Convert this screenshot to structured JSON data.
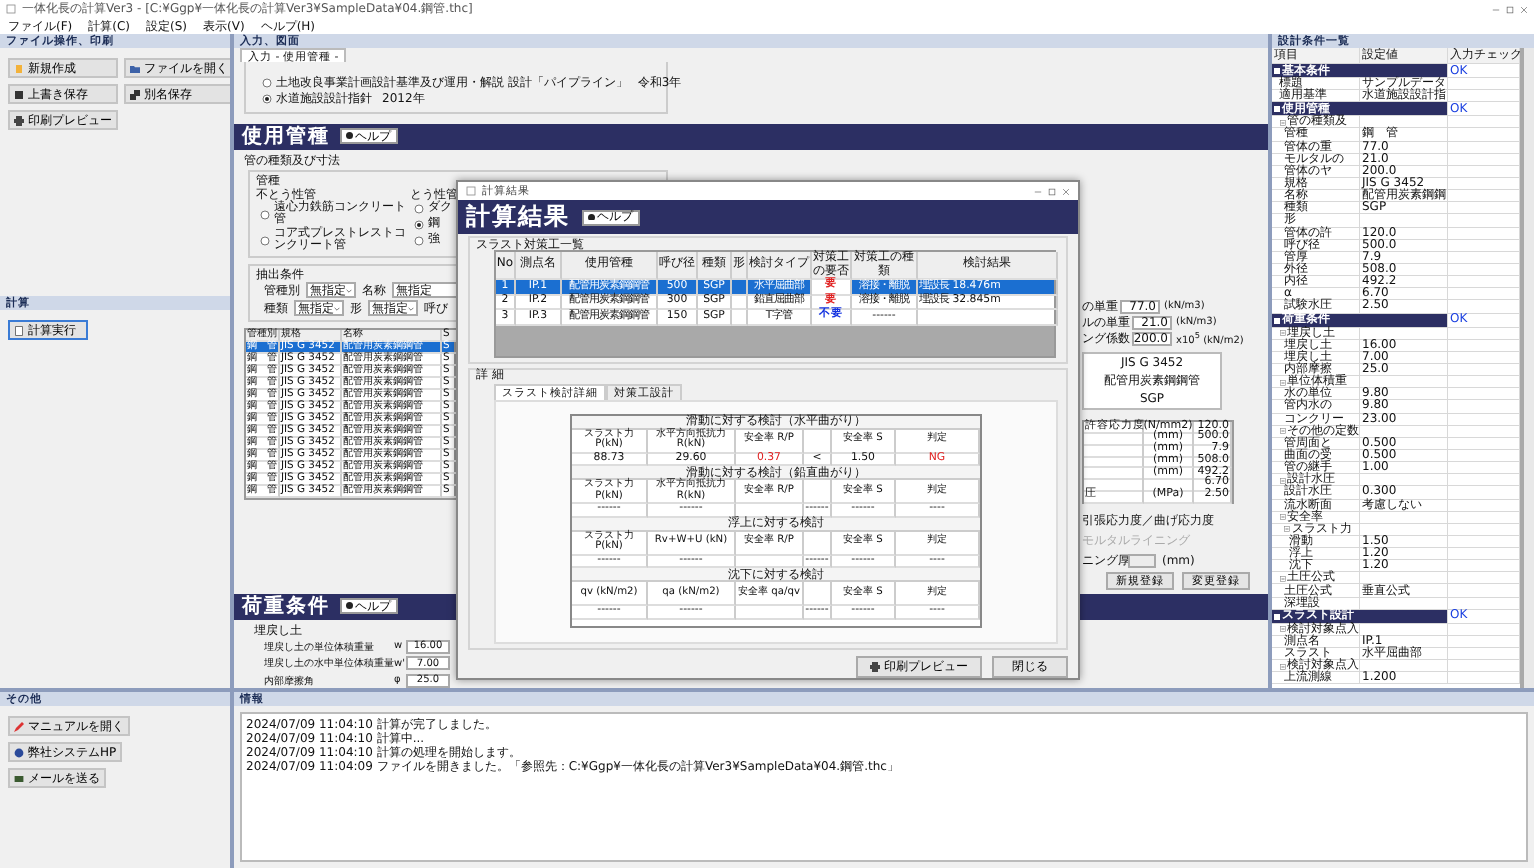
{
  "window": {
    "title": "一体化長の計算Ver3 - [C:¥Ggp¥一体化長の計算Ver3¥SampleData¥04.鋼管.thc]"
  },
  "menu": [
    "ファイル(F)",
    "計算(C)",
    "設定(S)",
    "表示(V)",
    "ヘルプ(H)"
  ],
  "file_panel": {
    "title": "ファイル操作、印刷",
    "buttons": [
      "新規作成",
      "ファイルを開く",
      "上書き保存",
      "別名保存",
      "印刷プレビュー"
    ]
  },
  "calc_panel": {
    "title": "計算",
    "buttons": [
      "計算実行"
    ]
  },
  "other_panel": {
    "title": "その他",
    "buttons": [
      "マニュアルを開く",
      "弊社システムHP",
      "メールを送る"
    ]
  },
  "input_panel": {
    "title": "入力、図面",
    "tabs": [
      {
        "label": "入力 - 使用管種 -",
        "selected": true
      }
    ],
    "standards": [
      {
        "label": "土地改良事業計画設計基準及び運用・解説 設計「パイプライン」",
        "year": "令和3年",
        "selected": false
      },
      {
        "label": "水道施設設計指針",
        "year": "2012年",
        "selected": true
      }
    ],
    "pipe_section": {
      "title": "使用管種",
      "help": "ヘルプ",
      "group_label": "管の種類及び寸法",
      "pipe_label": "管種",
      "rigid": {
        "label": "不とう性管",
        "options": [
          {
            "label": "遠心力鉄筋コンクリート管",
            "selected": false
          },
          {
            "label": "コア式プレストレストコンクリート管",
            "selected": false
          }
        ]
      },
      "flexible": {
        "label": "とう性管",
        "options": [
          {
            "label": "ダク",
            "selected": false
          },
          {
            "label": "鋼",
            "selected": true
          },
          {
            "label": "強",
            "selected": false
          }
        ]
      },
      "filter": {
        "title": "抽出条件",
        "fields": [
          {
            "label": "管種別",
            "value": "無指定",
            "kind": "dropdown"
          },
          {
            "label": "名称",
            "value": "無指定",
            "kind": "text"
          },
          {
            "label": "種類",
            "value": "無指定",
            "kind": "dropdown"
          },
          {
            "label": "形",
            "value": "無指定",
            "kind": "dropdown"
          },
          {
            "label": "呼び",
            "kind": "label"
          }
        ]
      },
      "table": {
        "columns": [
          "管種別",
          "規格",
          "名称",
          "S"
        ],
        "rows": [
          {
            "cells": [
              "鋼　管",
              "JIS G 3452",
              "配管用炭素鋼鋼管",
              "S"
            ],
            "selected": true
          },
          {
            "cells": [
              "鋼　管",
              "JIS G 3452",
              "配管用炭素鋼鋼管",
              "S"
            ],
            "selected": false
          },
          {
            "cells": [
              "鋼　管",
              "JIS G 3452",
              "配管用炭素鋼鋼管",
              "S"
            ],
            "selected": false
          },
          {
            "cells": [
              "鋼　管",
              "JIS G 3452",
              "配管用炭素鋼鋼管",
              "S"
            ],
            "selected": false
          },
          {
            "cells": [
              "鋼　管",
              "JIS G 3452",
              "配管用炭素鋼鋼管",
              "S"
            ],
            "selected": false
          },
          {
            "cells": [
              "鋼　管",
              "JIS G 3452",
              "配管用炭素鋼鋼管",
              "S"
            ],
            "selected": false
          },
          {
            "cells": [
              "鋼　管",
              "JIS G 3452",
              "配管用炭素鋼鋼管",
              "S"
            ],
            "selected": false
          },
          {
            "cells": [
              "鋼　管",
              "JIS G 3452",
              "配管用炭素鋼鋼管",
              "S"
            ],
            "selected": false
          },
          {
            "cells": [
              "鋼　管",
              "JIS G 3452",
              "配管用炭素鋼鋼管",
              "S"
            ],
            "selected": false
          },
          {
            "cells": [
              "鋼　管",
              "JIS G 3452",
              "配管用炭素鋼鋼管",
              "S"
            ],
            "selected": false
          },
          {
            "cells": [
              "鋼　管",
              "JIS G 3452",
              "配管用炭素鋼鋼管",
              "S"
            ],
            "selected": false
          },
          {
            "cells": [
              "鋼　管",
              "JIS G 3452",
              "配管用炭素鋼鋼管",
              "S"
            ],
            "selected": false
          },
          {
            "cells": [
              "鋼　管",
              "JIS G 3452",
              "配管用炭素鋼鋼管",
              "S"
            ],
            "selected": false
          }
        ]
      },
      "weights": [
        {
          "label": "の単重",
          "value": "77.0",
          "unit": "(kN/m3)"
        },
        {
          "label": "ルの単重",
          "value": "21.0",
          "unit": "(kN/m3)"
        },
        {
          "label": "ング係数",
          "value": "200.0",
          "unit": "x10$^{5}$ (kN/m2)"
        }
      ],
      "spec": [
        "JIS G 3452",
        "配管用炭素鋼鋼管",
        "SGP"
      ],
      "properties": [
        {
          "label": "許容応力度",
          "unit": "(N/mm2)",
          "value": "120.0"
        },
        {
          "unit": "(mm)",
          "value": "500.0"
        },
        {
          "unit": "(mm)",
          "value": "7.9"
        },
        {
          "unit": "(mm)",
          "value": "508.0"
        },
        {
          "unit": "(mm)",
          "value": "492.2"
        },
        {
          "value": "6.70"
        },
        {
          "label": "圧",
          "unit": "(MPa)",
          "value": "2.50"
        }
      ],
      "stress_label": "引張応力度／曲げ応力度",
      "lining": {
        "label": "モルタルライニング",
        "disabled": true
      },
      "lining_thickness": {
        "label": "ニング厚",
        "unit": "(mm)"
      },
      "buttons": [
        "新規登録",
        "変更登録"
      ]
    },
    "load_section": {
      "title": "荷重条件",
      "help": "ヘルプ",
      "group_label": "埋戻し土",
      "rows": [
        {
          "label": "埋戻し土の単位体積重量",
          "symbol": "w",
          "value": "16.00"
        },
        {
          "label": "埋戻し土の水中単位体積重量",
          "symbol": "w'",
          "value": "7.00"
        },
        {
          "label": "内部摩擦角",
          "symbol": "φ",
          "value": "25.0"
        }
      ]
    }
  },
  "log": {
    "title": "情報",
    "lines": [
      "2024/07/09 11:04:10 計算が完了しました。",
      "2024/07/09 11:04:10 計算中...",
      "2024/07/09 11:04:10 計算の処理を開始します。",
      "2024/07/09 11:04:09 ファイルを開きました。「参照先：C:¥Ggp¥一体化長の計算Ver3¥SampleData¥04.鋼管.thc」"
    ]
  },
  "dialog": {
    "title": "計算結果",
    "banner": "計算結果",
    "help": "ヘルプ",
    "list_title": "スラスト対策工一覧",
    "columns": [
      "No",
      "測点名",
      "使用管種",
      "呼び径",
      "種類",
      "形",
      "検討タイプ",
      "対策工の要否",
      "対策工の種類",
      "検討結果"
    ],
    "rows": [
      {
        "no": "1",
        "name": "IP.1",
        "pipe": "配管用炭素鋼鋼管",
        "diameter": "500",
        "type": "SGP",
        "check_type": "水平屈曲部",
        "needed": "要",
        "measure": "溶接・離脱",
        "result": "埋設長 18.476m",
        "color": "#e02020",
        "selected": true
      },
      {
        "no": "2",
        "name": "IP.2",
        "pipe": "配管用炭素鋼鋼管",
        "diameter": "300",
        "type": "SGP",
        "check_type": "鉛直屈曲部",
        "needed": "要",
        "measure": "溶接・離脱",
        "result": "埋設長 32.845m",
        "color": "#e02020",
        "selected": false
      },
      {
        "no": "3",
        "name": "IP.3",
        "pipe": "配管用炭素鋼鋼管",
        "diameter": "150",
        "type": "SGP",
        "check_type": "T字管",
        "needed": "不要",
        "measure": "------",
        "color": "#1030e0",
        "selected": false
      }
    ],
    "detail_title": "詳 細",
    "tabs": [
      {
        "label": "スラスト検討詳細",
        "selected": true
      },
      {
        "label": "対策工設計",
        "selected": false
      }
    ],
    "checks": [
      {
        "title": "滑動に対する検討（水平曲がり）",
        "headers": {
          "force": "スラスト力 P(kN)",
          "resistance": "水平方向抵抗力 R(kN)",
          "ratio": "安全率 R/P",
          "safety": "安全率 S",
          "verdict": "判定"
        },
        "values": {
          "force": "88.73",
          "resistance": "29.60",
          "ratio": "0.37",
          "compare": "<",
          "safety": "1.50",
          "verdict": "NG"
        },
        "ng": true
      },
      {
        "title": "滑動に対する検討（鉛直曲がり）",
        "headers": {
          "force": "スラスト力 P(kN)",
          "resistance": "水平方向抵抗力 R(kN)",
          "ratio": "安全率 R/P",
          "safety": "安全率 S",
          "verdict": "判定"
        },
        "values": {
          "force": "------",
          "resistance": "------",
          "compare": "------",
          "safety": "------",
          "verdict": "----"
        },
        "ng": false
      },
      {
        "title": "浮上に対する検討",
        "headers": {
          "force": "スラスト力 P(kN)",
          "resistance": "Rv+W+U (kN)",
          "ratio": "安全率 R/P",
          "safety": "安全率 S",
          "verdict": "判定"
        },
        "values": {
          "force": "------",
          "resistance": "------",
          "compare": "------",
          "safety": "------",
          "verdict": "----"
        },
        "ng": false
      },
      {
        "title": "沈下に対する検討",
        "headers": {
          "force": "qv (kN/m2)",
          "resistance": "qa (kN/m2)",
          "ratio": "安全率 qa/qv",
          "safety": "安全率 S",
          "verdict": "判定"
        },
        "values": {
          "force": "------",
          "resistance": "------",
          "compare": "------",
          "safety": "------",
          "verdict": "----"
        },
        "ng": false
      }
    ],
    "buttons": [
      "印刷プレビュー",
      "閉じる"
    ]
  },
  "conditions": {
    "title": "設計条件一覧",
    "columns": [
      "項目",
      "設定値",
      "入力チェック"
    ],
    "sections": [
      {
        "label": "基本条件",
        "check": "OK",
        "children": [
          {
            "label": "標題",
            "value": "サンプルデータ"
          },
          {
            "label": "適用基準",
            "value": "水道施設設計指"
          }
        ]
      },
      {
        "label": "使用管種",
        "check": "OK",
        "children": [
          {
            "label": "管の種類及",
            "expanded": true,
            "children": [
              {
                "label": "管種",
                "value": "鋼　管"
              },
              {
                "label": "管体の重",
                "value": "77.0"
              },
              {
                "label": "モルタルの",
                "value": "21.0"
              },
              {
                "label": "管体のヤ",
                "value": "200.0"
              },
              {
                "label": "規格",
                "value": "JIS G 3452"
              },
              {
                "label": "名称",
                "value": "配管用炭素鋼鋼"
              },
              {
                "label": "種類",
                "value": "SGP"
              },
              {
                "label": "形"
              },
              {
                "label": "管体の許",
                "value": "120.0"
              },
              {
                "label": "呼び径",
                "value": "500.0"
              },
              {
                "label": "管厚",
                "value": "7.9"
              },
              {
                "label": "外径",
                "value": "508.0"
              },
              {
                "label": "内径",
                "value": "492.2"
              },
              {
                "label": "α",
                "value": "6.70"
              },
              {
                "label": "試験水圧",
                "value": "2.50"
              }
            ]
          }
        ]
      },
      {
        "label": "荷重条件",
        "check": "OK",
        "children": [
          {
            "label": "埋戻し土",
            "expanded": true,
            "children": [
              {
                "label": "埋戻し土",
                "value": "16.00"
              },
              {
                "label": "埋戻し土",
                "value": "7.00"
              },
              {
                "label": "内部摩擦",
                "value": "25.0"
              }
            ]
          },
          {
            "label": "単位体積重",
            "expanded": true,
            "children": [
              {
                "label": "水の単位",
                "value": "9.80"
              },
              {
                "label": "管内水の",
                "value": "9.80"
              },
              {
                "label": "コンクリー",
                "value": "23.00"
              }
            ]
          },
          {
            "label": "その他の定数",
            "expanded": true,
            "children": [
              {
                "label": "管周面と",
                "value": "0.500"
              },
              {
                "label": "曲面の受",
                "value": "0.500"
              },
              {
                "label": "管の継手",
                "value": "1.00"
              }
            ]
          },
          {
            "label": "設計水圧",
            "expanded": true,
            "children": [
              {
                "label": "設計水圧",
                "value": "0.300"
              },
              {
                "label": "流水断面",
                "value": "考慮しない"
              }
            ]
          },
          {
            "label": "安全率",
            "expanded": true,
            "children": [
              {
                "label": "スラスト力",
                "expanded": true,
                "children": [
                  {
                    "label": "滑動",
                    "value": "1.50"
                  },
                  {
                    "label": "浮上",
                    "value": "1.20"
                  },
                  {
                    "label": "沈下",
                    "value": "1.20"
                  }
                ]
              }
            ]
          },
          {
            "label": "土圧公式",
            "expanded": true,
            "children": [
              {
                "label": "土圧公式",
                "value": "垂直公式"
              },
              {
                "label": "深埋設"
              }
            ]
          }
        ]
      },
      {
        "label": "スラスト設計",
        "check": "OK",
        "children": [
          {
            "label": "検討対象点入",
            "expanded": true,
            "children": [
              {
                "label": "測点名",
                "value": "IP.1"
              },
              {
                "label": "スラスト",
                "value": "水平屈曲部"
              }
            ]
          },
          {
            "label": "検討対象点入",
            "expanded": true,
            "children": [
              {
                "label": "上流測線",
                "value": "1.200"
              }
            ]
          }
        ]
      }
    ]
  }
}
